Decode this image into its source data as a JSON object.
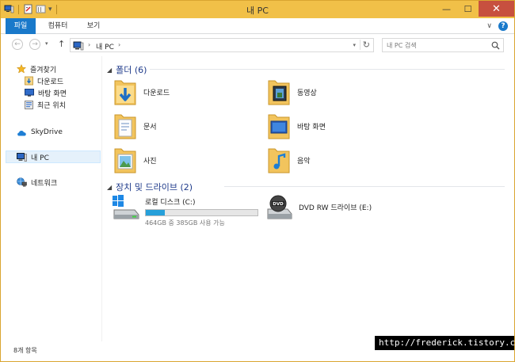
{
  "window": {
    "title": "내 PC",
    "minimize": "—",
    "maximize": "☐",
    "close": "✕"
  },
  "ribbon": {
    "tabs": [
      "파일",
      "컴퓨터",
      "보기"
    ],
    "expand": "∨",
    "help": "?"
  },
  "navigation": {
    "back": "←",
    "forward": "→",
    "recent_dropdown": "▾",
    "up": "↑",
    "address_separator": "›",
    "address_crumb": "내 PC",
    "address_dropdown": "▾",
    "refresh": "↻",
    "search_placeholder": "내 PC 검색"
  },
  "sidebar": {
    "favorites": "즐겨찾기",
    "favorites_items": [
      "다운로드",
      "바탕 화면",
      "최근 위치"
    ],
    "skydrive": "SkyDrive",
    "this_pc": "내 PC",
    "network": "네트워크"
  },
  "folders_group": {
    "header": "폴더 (6)",
    "collapse_glyph": "◢",
    "items": [
      "다운로드",
      "동영상",
      "문서",
      "바탕 화면",
      "사진",
      "음악"
    ]
  },
  "drives_group": {
    "header": "장치 및 드라이브 (2)",
    "collapse_glyph": "◢",
    "local_disk": {
      "name": "로컬 디스크 (C:)",
      "space": "464GB 중 385GB 사용 가능",
      "used_fraction": 0.17
    },
    "dvd": {
      "name": "DVD RW 드라이브 (E:)"
    }
  },
  "status": {
    "item_count": "8개 항목"
  },
  "watermark": "http://frederick.tistory.com",
  "colors": {
    "titlebar": "#f1c048",
    "accent": "#1979ca",
    "progress": "#26a0da",
    "close": "#c7503f"
  }
}
